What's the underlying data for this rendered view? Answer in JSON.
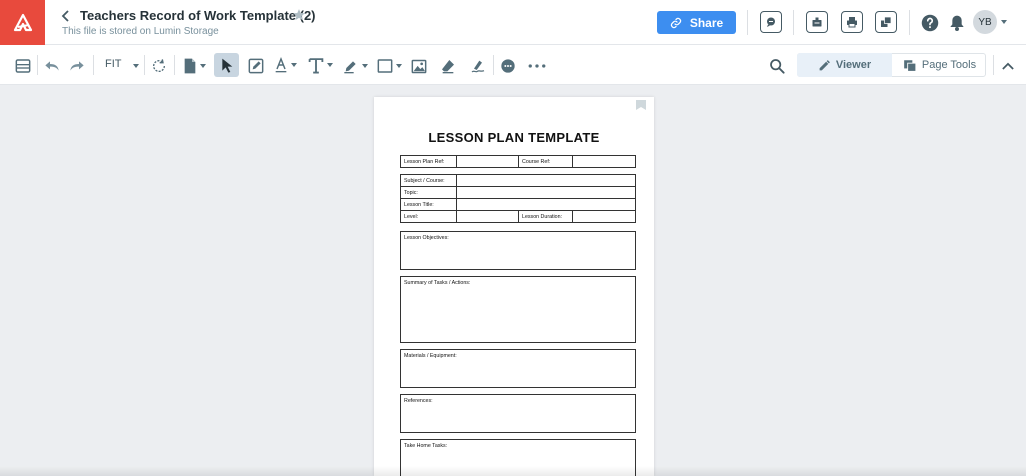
{
  "header": {
    "title": "Teachers Record of Work Template (2)",
    "subtitle": "This file is stored on Lumin Storage",
    "share_label": "Share",
    "avatar_initials": "YB",
    "accent_color": "#3d8ef0",
    "logo_color": "#e84a3d"
  },
  "toolbar": {
    "zoom_label": "FIT",
    "viewer_label": "Viewer",
    "page_tools_label": "Page Tools"
  },
  "document": {
    "heading": "LESSON PLAN TEMPLATE",
    "ref_row": {
      "lesson_plan_ref": "Lesson Plan Ref:",
      "course_ref": "Course Ref:"
    },
    "info_rows": {
      "subject": "Subject / Course:",
      "topic": "Topic:",
      "lesson_title": "Lesson Title:",
      "level": "Level:",
      "lesson_duration": "Lesson Duration:"
    },
    "sections": {
      "objectives": "Lesson Objectives:",
      "summary": "Summary of Tasks / Actions:",
      "materials": "Materials / Equipment:",
      "references": "References:",
      "take_home": "Take Home Tasks:"
    }
  }
}
